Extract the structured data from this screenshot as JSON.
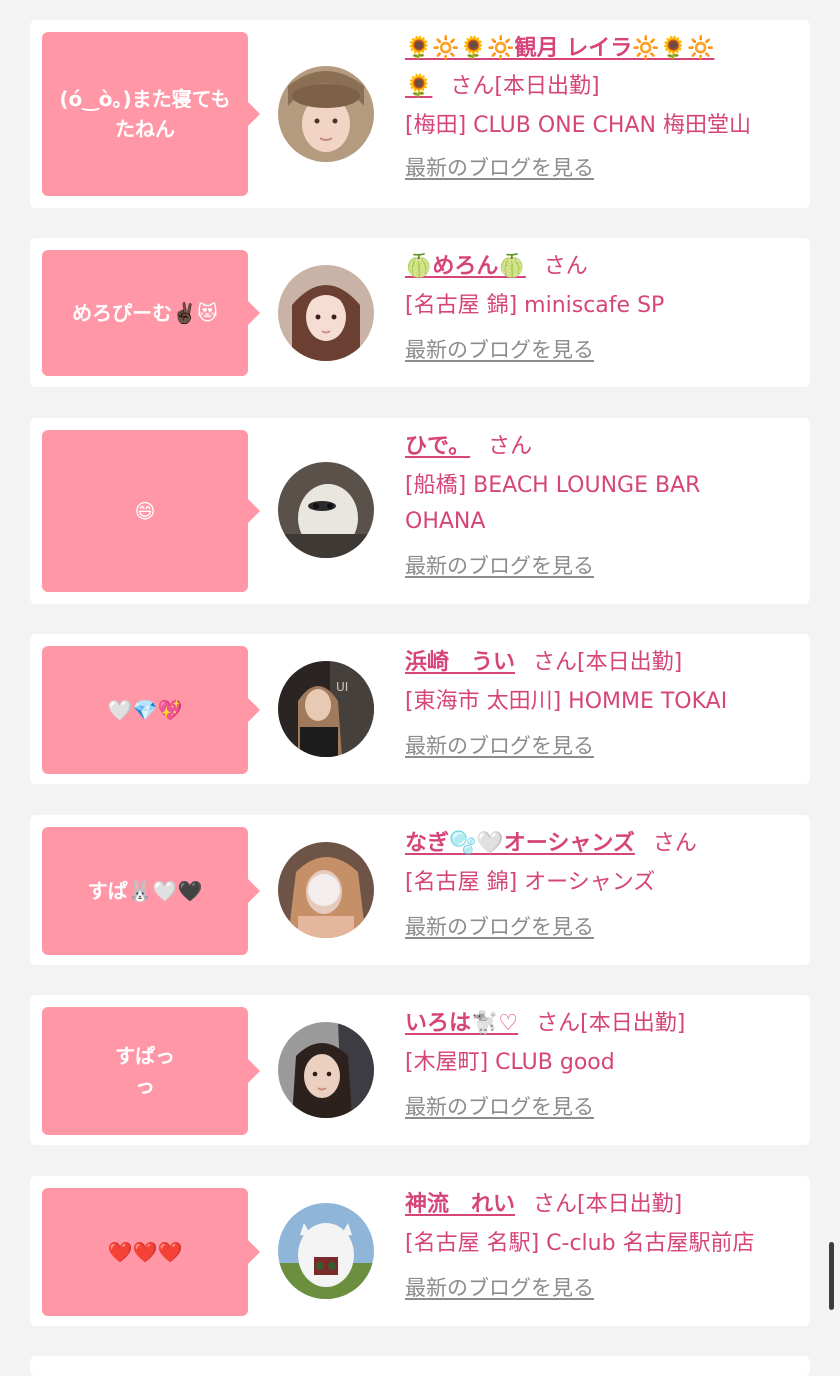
{
  "colors": {
    "page_bg": "#f3f3f3",
    "card_bg": "#ffffff",
    "bubble_bg": "#ff97a6",
    "accent": "#d6457a",
    "link_gray": "#8c8c8c"
  },
  "san": "さん",
  "blog_link": "最新のブログを見る",
  "posts": [
    {
      "message": "(ó‿ò｡)また寝ても\nたねん",
      "name": "🌻🔆🌻🔆観月 レイラ🔆🌻🔆\n🌻",
      "status": "[本日出勤]",
      "shop": "[梅田] CLUB ONE CHAN 梅田堂山"
    },
    {
      "message": "めろぴーむ✌🏿😻",
      "name": "🍈めろん🍈",
      "status": "",
      "shop": "[名古屋 錦] miniscafe SP"
    },
    {
      "message": "😄",
      "name": "ひで。",
      "status": "",
      "shop": "[船橋] BEACH LOUNGE BAR OHANA"
    },
    {
      "message": "🤍💎💖",
      "name": "浜崎　うい",
      "status": "[本日出勤]",
      "shop": "[東海市 太田川] HOMME TOKAI"
    },
    {
      "message": "すぱ🐰🤍🖤",
      "name": "なぎ🫧🤍オーシャンズ",
      "status": "",
      "shop": "[名古屋 錦] オーシャンズ"
    },
    {
      "message": "すぱっ\nっ",
      "name": "いろは🐩♡",
      "status": "[本日出勤]",
      "shop": "[木屋町] CLUB good"
    },
    {
      "message": "❤️❤️❤️",
      "name": "神流　れい",
      "status": "[本日出勤]",
      "shop": "[名古屋 名駅] C-club 名古屋駅前店"
    }
  ]
}
